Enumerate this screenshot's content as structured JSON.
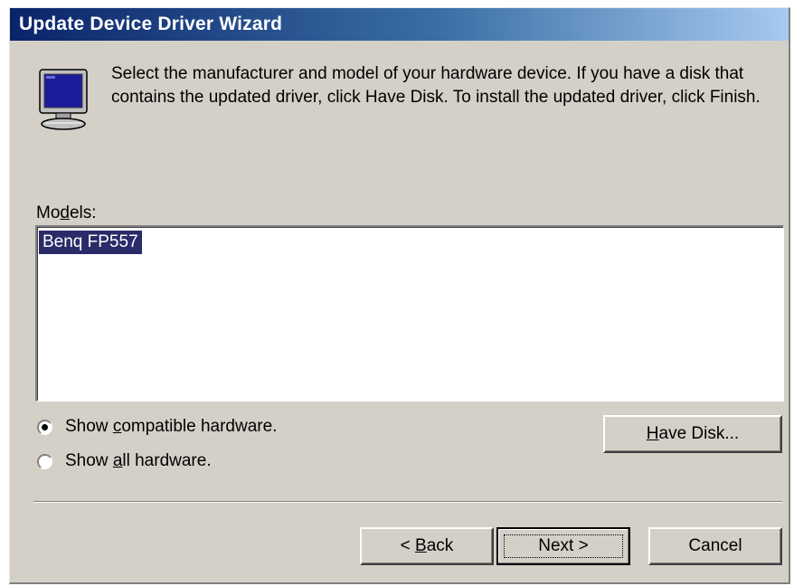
{
  "window": {
    "title": "Update Device Driver Wizard"
  },
  "header": {
    "icon": "monitor-icon",
    "description": "Select the manufacturer and model of your hardware device. If you have a disk that contains the updated driver, click Have Disk. To install the updated driver, click Finish."
  },
  "models": {
    "label_pre": "Mo",
    "label_accel": "d",
    "label_post": "els:",
    "items": [
      {
        "label": "Benq FP557",
        "selected": true
      }
    ]
  },
  "filter": {
    "compatible": {
      "pre": "Show ",
      "accel": "c",
      "post": "ompatible hardware.",
      "checked": true
    },
    "all": {
      "pre": "Show ",
      "accel": "a",
      "post": "ll hardware.",
      "checked": false
    }
  },
  "buttons": {
    "have_disk": {
      "accel": "H",
      "post": "ave Disk..."
    },
    "back": {
      "pre": "< ",
      "accel": "B",
      "post": "ack"
    },
    "next": "Next >",
    "cancel": "Cancel"
  },
  "colors": {
    "titlebar_start": "#0a246a",
    "titlebar_end": "#a6caf0",
    "face": "#d4d0c8",
    "selection": "#2b2b6a"
  }
}
